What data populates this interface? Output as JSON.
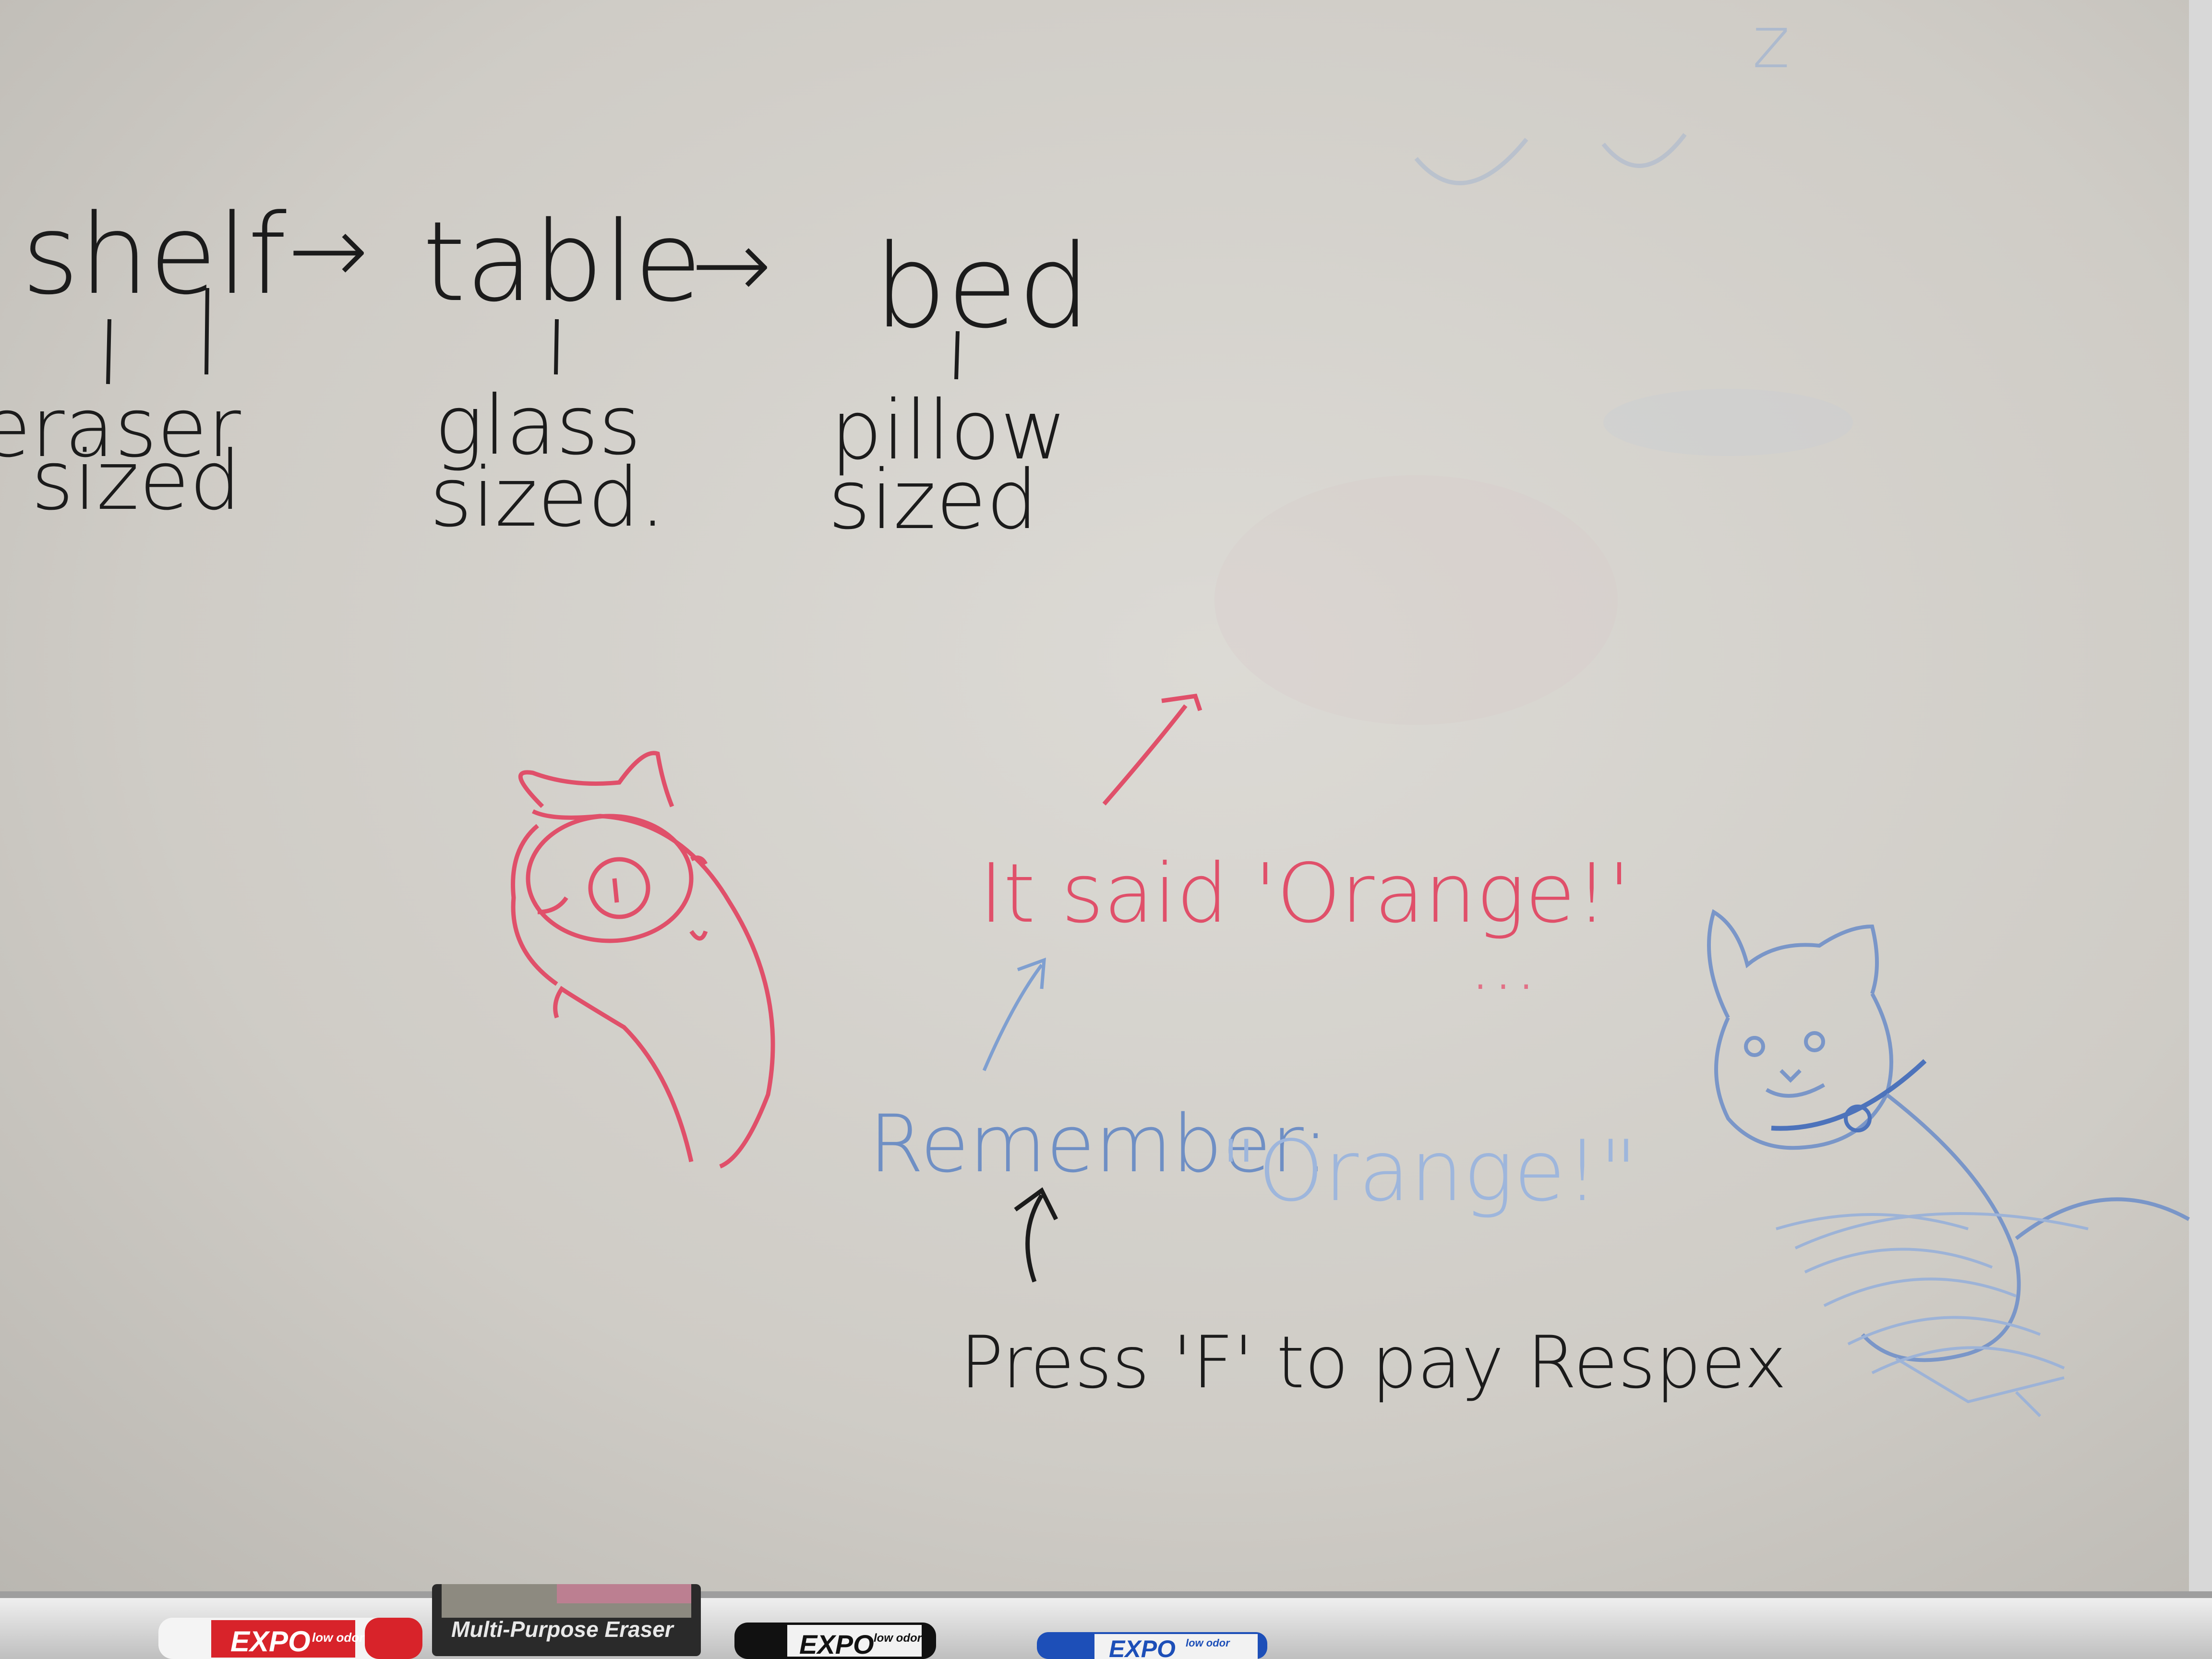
{
  "colors": {
    "board_light": "#dcdad5",
    "board_mid": "#cfccc6",
    "board_dark": "#b9b6b0",
    "ink_black": "#1b1b1b",
    "ink_red": "#e0506a",
    "ink_blue": "#6f8fc4",
    "tray": "#e9e9e9",
    "marker_red": "#d8232a",
    "marker_blue": "#1d4fb8",
    "marker_black": "#111111"
  },
  "hierarchy": {
    "items": [
      {
        "word": "shelf",
        "size_line1": "eraser",
        "size_line2": "sized"
      },
      {
        "word": "table",
        "size_line1": "glass",
        "size_line2": "sized."
      },
      {
        "word": "bed",
        "size_line1": "pillow",
        "size_line2": "sized"
      }
    ],
    "arrow": "→"
  },
  "corner_mark": "z",
  "red_note": "It said 'Orange!'",
  "red_dots": "...",
  "blue_note": {
    "label": "Remember:",
    "quote": "\"Orange!\""
  },
  "black_note": "Press 'F' to pay Respex",
  "tray": {
    "eraser_label": "Multi-Purpose Eraser",
    "marker_brand": "EXPO",
    "marker_sub": "low odor"
  }
}
